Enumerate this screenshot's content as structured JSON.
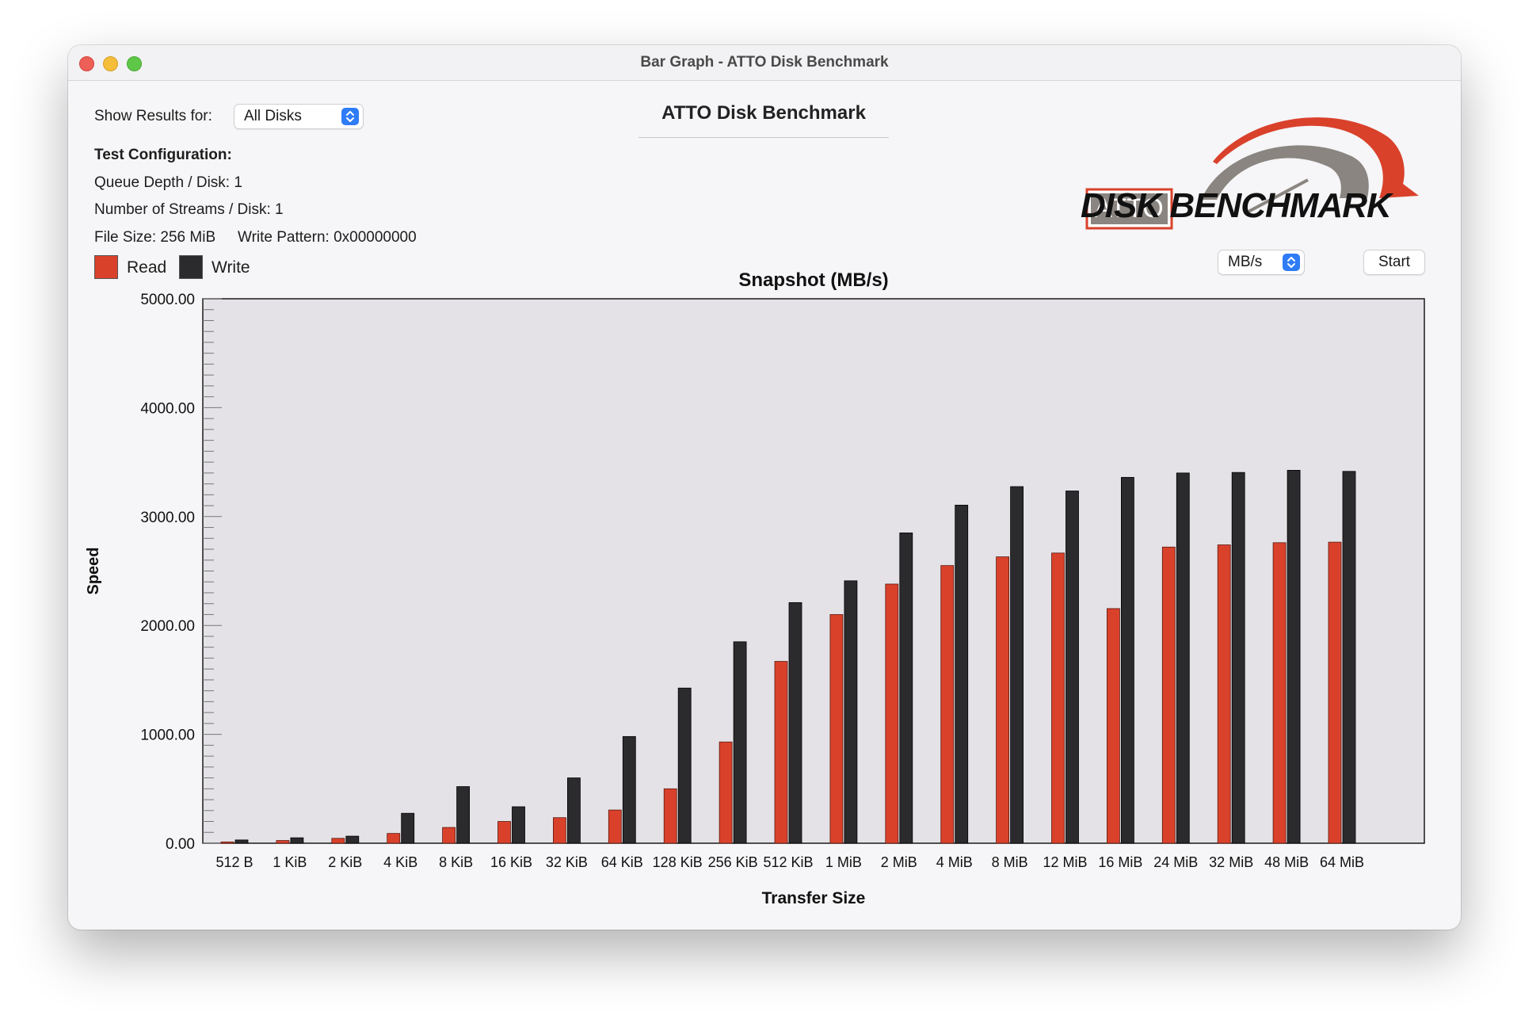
{
  "window": {
    "title": "Bar Graph - ATTO Disk Benchmark"
  },
  "controls": {
    "show_results_label": "Show Results for:",
    "disk_select_value": "All Disks",
    "units_select_value": "MB/s",
    "start_button_label": "Start"
  },
  "header": {
    "title": "ATTO Disk Benchmark"
  },
  "logo": {
    "brand": "ATTO",
    "product": "DISK BENCHMARK",
    "accent_color": "#d9412b",
    "gauge_color": "#8a8580"
  },
  "config": {
    "heading": "Test Configuration:",
    "queue_depth": "Queue Depth / Disk: 1",
    "streams": "Number of Streams / Disk: 1",
    "file_size": "File Size: 256 MiB",
    "write_pattern": "Write Pattern: 0x00000000"
  },
  "legend": {
    "read_label": "Read",
    "write_label": "Write"
  },
  "colors": {
    "read": "#d9412b",
    "write": "#2b2a2d",
    "plot_bg": "#e4e2e6"
  },
  "chart_data": {
    "type": "bar",
    "title": "Snapshot (MB/s)",
    "xlabel": "Transfer Size",
    "ylabel": "Speed",
    "ylim": [
      0,
      5000
    ],
    "yticks": [
      "0.00",
      "1000.00",
      "2000.00",
      "3000.00",
      "4000.00",
      "5000.00"
    ],
    "categories": [
      "512 B",
      "1 KiB",
      "2 KiB",
      "4 KiB",
      "8 KiB",
      "16 KiB",
      "32 KiB",
      "64 KiB",
      "128 KiB",
      "256 KiB",
      "512 KiB",
      "1 MiB",
      "2 MiB",
      "4 MiB",
      "8 MiB",
      "12 MiB",
      "16 MiB",
      "24 MiB",
      "32 MiB",
      "48 MiB",
      "64 MiB"
    ],
    "series": [
      {
        "name": "Read",
        "values": [
          12,
          25,
          45,
          90,
          145,
          200,
          235,
          305,
          500,
          930,
          1670,
          2100,
          2380,
          2550,
          2630,
          2665,
          2155,
          2720,
          2740,
          2760,
          2765
        ]
      },
      {
        "name": "Write",
        "values": [
          30,
          50,
          65,
          275,
          520,
          335,
          600,
          980,
          1425,
          1850,
          2210,
          2410,
          2850,
          3105,
          3275,
          3235,
          3360,
          3400,
          3405,
          3425,
          3415
        ]
      }
    ],
    "grid": false,
    "legend_position": "top-left"
  }
}
